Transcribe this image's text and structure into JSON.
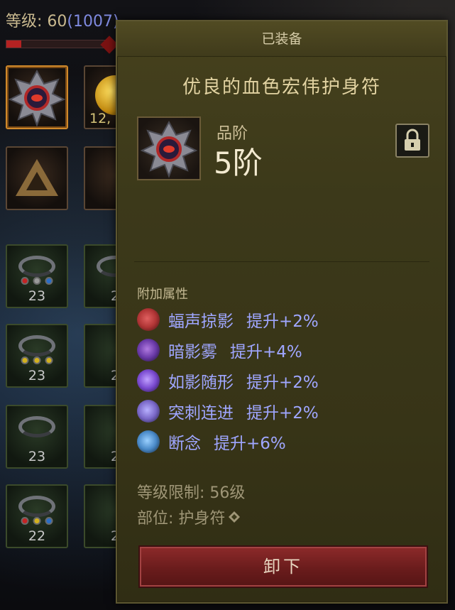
{
  "character": {
    "level_label": "等级: 60",
    "level_paren": "(1007)",
    "xp_fraction": 0.14
  },
  "inventory": {
    "slots": [
      {
        "count": ""
      },
      {
        "count": "12,"
      },
      {
        "count": ""
      },
      {
        "count": ""
      },
      {
        "count": "23"
      },
      {
        "count": "2"
      },
      {
        "count": "23"
      },
      {
        "count": "2"
      },
      {
        "count": "23"
      },
      {
        "count": "2"
      },
      {
        "count": "22"
      },
      {
        "count": "2"
      }
    ]
  },
  "tooltip": {
    "header": "已装备",
    "item_name": "优良的血色宏伟护身符",
    "tier_label": "品阶",
    "tier_value": "5阶",
    "affix_title": "附加属性",
    "affixes": [
      {
        "name": "蝠声掠影",
        "bonus": "提升+2%",
        "icon": "bat-skill-icon",
        "color": "#b03535"
      },
      {
        "name": "暗影雾",
        "bonus": "提升+4%",
        "icon": "shadow-mist-skill-icon",
        "color": "#6a3aa8"
      },
      {
        "name": "如影随形",
        "bonus": "提升+2%",
        "icon": "shadow-follow-skill-icon",
        "color": "#7a4ad0"
      },
      {
        "name": "突刺连进",
        "bonus": "提升+2%",
        "icon": "thrust-skill-icon",
        "color": "#7a68c8"
      },
      {
        "name": "断念",
        "bonus": "提升+6%",
        "icon": "sever-skill-icon",
        "color": "#4a8ac8"
      }
    ],
    "requirement": "等级限制: 56级",
    "slot_type": "部位: 护身符",
    "unequip_label": "卸下"
  },
  "colors": {
    "affix_text": "#9fa6ff",
    "panel_bg": "#3c391a",
    "unequip_button": "#6a1c1c"
  }
}
